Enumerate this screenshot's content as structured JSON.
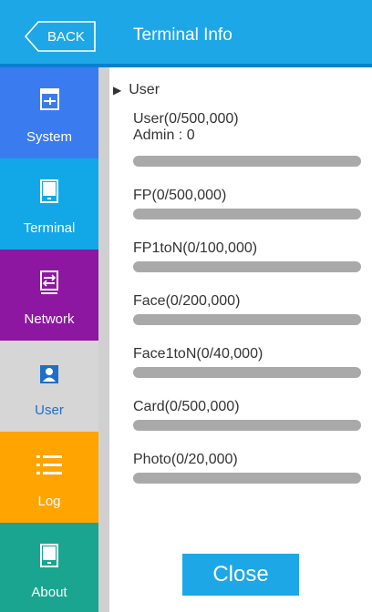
{
  "header": {
    "back_label": "BACK",
    "title": "Terminal Info",
    "color": "#1ea7e6"
  },
  "sidebar": {
    "items": [
      {
        "label": "System",
        "icon": "system-icon",
        "color": "#3a7bf0"
      },
      {
        "label": "Terminal",
        "icon": "terminal-icon",
        "color": "#12a8e8"
      },
      {
        "label": "Network",
        "icon": "network-icon",
        "color": "#8e17a2"
      },
      {
        "label": "User",
        "icon": "user-icon",
        "color": "#d6d6d6",
        "selected": true
      },
      {
        "label": "Log",
        "icon": "log-icon",
        "color": "#ffa400"
      },
      {
        "label": "About",
        "icon": "about-icon",
        "color": "#19a590"
      }
    ]
  },
  "main": {
    "section": "User",
    "stats": [
      {
        "label": "User(0/500,000)",
        "sub": "Admin : 0",
        "used": 0,
        "total": 500000
      },
      {
        "label": "FP(0/500,000)",
        "used": 0,
        "total": 500000
      },
      {
        "label": "FP1toN(0/100,000)",
        "used": 0,
        "total": 100000
      },
      {
        "label": "Face(0/200,000)",
        "used": 0,
        "total": 200000
      },
      {
        "label": "Face1toN(0/40,000)",
        "used": 0,
        "total": 40000
      },
      {
        "label": "Card(0/500,000)",
        "used": 0,
        "total": 500000
      },
      {
        "label": "Photo(0/20,000)",
        "used": 0,
        "total": 20000
      }
    ],
    "close_label": "Close"
  }
}
